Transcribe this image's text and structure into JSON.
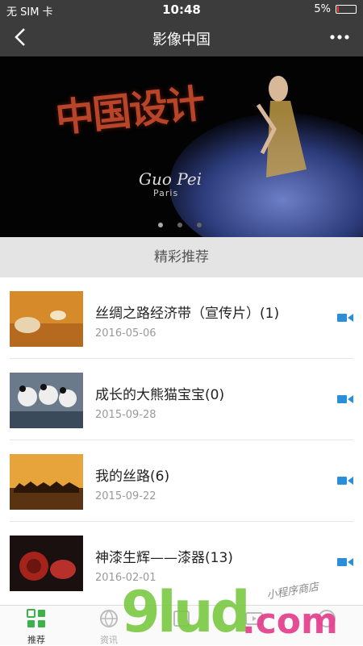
{
  "status_bar": {
    "carrier": "无 SIM 卡",
    "time": "10:48",
    "battery": "5%"
  },
  "nav": {
    "title": "影像中国"
  },
  "banner": {
    "text": "中国设计",
    "signature": "Guo Pei",
    "sub": "Paris",
    "slide_count": 3,
    "active_slide": 1
  },
  "section": {
    "title": "精彩推荐"
  },
  "items": [
    {
      "title": "丝绸之路经济带（宣传片）(1)",
      "date": "2016-05-06",
      "thumb_icon": "silk-road-thumb"
    },
    {
      "title": "成长的大熊猫宝宝(0)",
      "date": "2015-09-28",
      "thumb_icon": "panda-thumb"
    },
    {
      "title": "我的丝路(6)",
      "date": "2015-09-22",
      "thumb_icon": "camel-caravan-thumb"
    },
    {
      "title": "神漆生辉——漆器(13)",
      "date": "2016-02-01",
      "thumb_icon": "lacquerware-thumb"
    }
  ],
  "tabs": [
    {
      "label": "推荐",
      "icon": "grid-icon",
      "active": true
    },
    {
      "label": "资讯",
      "icon": "globe-icon",
      "active": false
    },
    {
      "label": "",
      "icon": "tab-icon",
      "active": false
    },
    {
      "label": "",
      "icon": "video-icon",
      "active": false
    },
    {
      "label": "",
      "icon": "circle-icon",
      "active": false
    }
  ],
  "watermark": {
    "brand": "9lud",
    "suffix": ".com",
    "tagline": "小程序商店"
  },
  "colors": {
    "bar": "#3c3c3c",
    "accent": "#3bb34a",
    "video_icon": "#2a8fd8"
  }
}
